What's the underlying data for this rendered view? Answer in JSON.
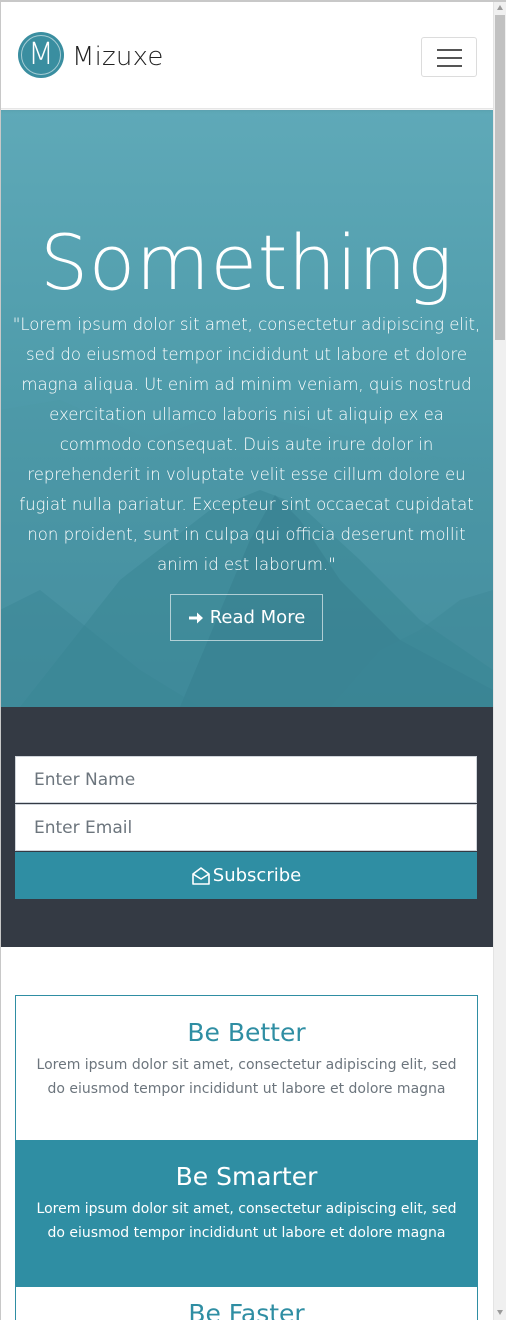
{
  "navbar": {
    "logo_letter": "M",
    "brand": "Mizuxe",
    "menu_icon": "hamburger-menu-icon"
  },
  "hero": {
    "title": "Something",
    "text": "\"Lorem ipsum dolor sit amet, consectetur adipiscing elit, sed do eiusmod tempor incididunt ut labore et dolore magna aliqua. Ut enim ad minim veniam, quis nostrud exercitation ullamco laboris nisi ut aliquip ex ea commodo consequat. Duis aute irure dolor in reprehenderit in voluptate velit esse cillum dolore eu fugiat nulla pariatur. Excepteur sint occaecat cupidatat non proident, sunt in culpa qui officia deserunt mollit anim id est laborum.\"",
    "button_label": "Read More",
    "button_icon": "arrow-right-icon"
  },
  "subscribe": {
    "name_placeholder": "Enter Name",
    "email_placeholder": "Enter Email",
    "button_label": "Subscribe",
    "button_icon": "envelope-open-icon"
  },
  "features": [
    {
      "title": "Be Better",
      "text": "Lorem ipsum dolor sit amet, consectetur adipiscing elit, sed do eiusmod tempor incididunt ut labore et dolore magna"
    },
    {
      "title": "Be Smarter",
      "text": "Lorem ipsum dolor sit amet, consectetur adipiscing elit, sed do eiusmod tempor incididunt ut labore et dolore magna"
    },
    {
      "title": "Be Faster"
    }
  ],
  "colors": {
    "primary": "#2f8ea3",
    "dark": "#343a44",
    "hero_overlay": "#4f9cab"
  }
}
